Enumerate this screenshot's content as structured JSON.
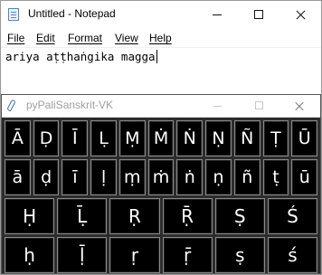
{
  "notepad": {
    "title": "Untitled - Notepad",
    "menu": [
      "File",
      "Edit",
      "Format",
      "View",
      "Help"
    ],
    "content": "ariya aṭṭhaṅgika magga"
  },
  "keyboard": {
    "title": "pyPaliSanskrit-VK",
    "rows": [
      [
        "Ā",
        "Ḍ",
        "Ī",
        "Ḷ",
        "Ṃ",
        "Ṁ",
        "Ṅ",
        "Ṇ",
        "Ñ",
        "Ṭ",
        "Ū"
      ],
      [
        "ā",
        "ḍ",
        "ī",
        "ḷ",
        "ṃ",
        "ṁ",
        "ṅ",
        "ṇ",
        "ñ",
        "ṭ",
        "ū"
      ],
      [
        "Ḥ",
        "Ḹ",
        "Ṛ",
        "Ṝ",
        "Ṣ",
        "Ś"
      ],
      [
        "ḥ",
        "ḹ",
        "ṛ",
        "ṝ",
        "ṣ",
        "ś"
      ]
    ]
  },
  "icons": {
    "notepad_app": "notepad-icon",
    "keyboard_app": "feather-icon",
    "minimize": "minimize-icon",
    "maximize": "maximize-icon",
    "close": "close-icon"
  }
}
